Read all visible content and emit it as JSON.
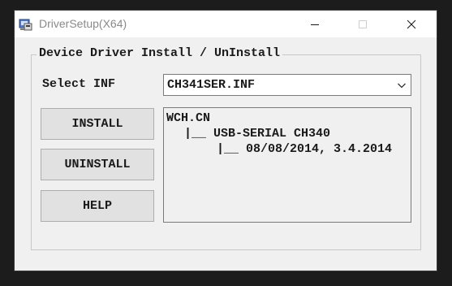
{
  "window": {
    "title": "DriverSetup(X64)"
  },
  "group": {
    "label": "Device Driver Install / UnInstall"
  },
  "select_inf": {
    "label": "Select INF",
    "value": "CH341SER.INF"
  },
  "buttons": {
    "install": "INSTALL",
    "uninstall": "UNINSTALL",
    "help": "HELP"
  },
  "driver_info": {
    "vendor": "WCH.CN",
    "device": "|__ USB-SERIAL CH340",
    "version": "|__ 08/08/2014, 3.4.2014"
  },
  "icons": {
    "app": "driver-setup-app-icon",
    "minimize": "minimize-icon",
    "maximize": "maximize-icon",
    "close": "close-icon",
    "dropdown": "chevron-down-icon"
  }
}
